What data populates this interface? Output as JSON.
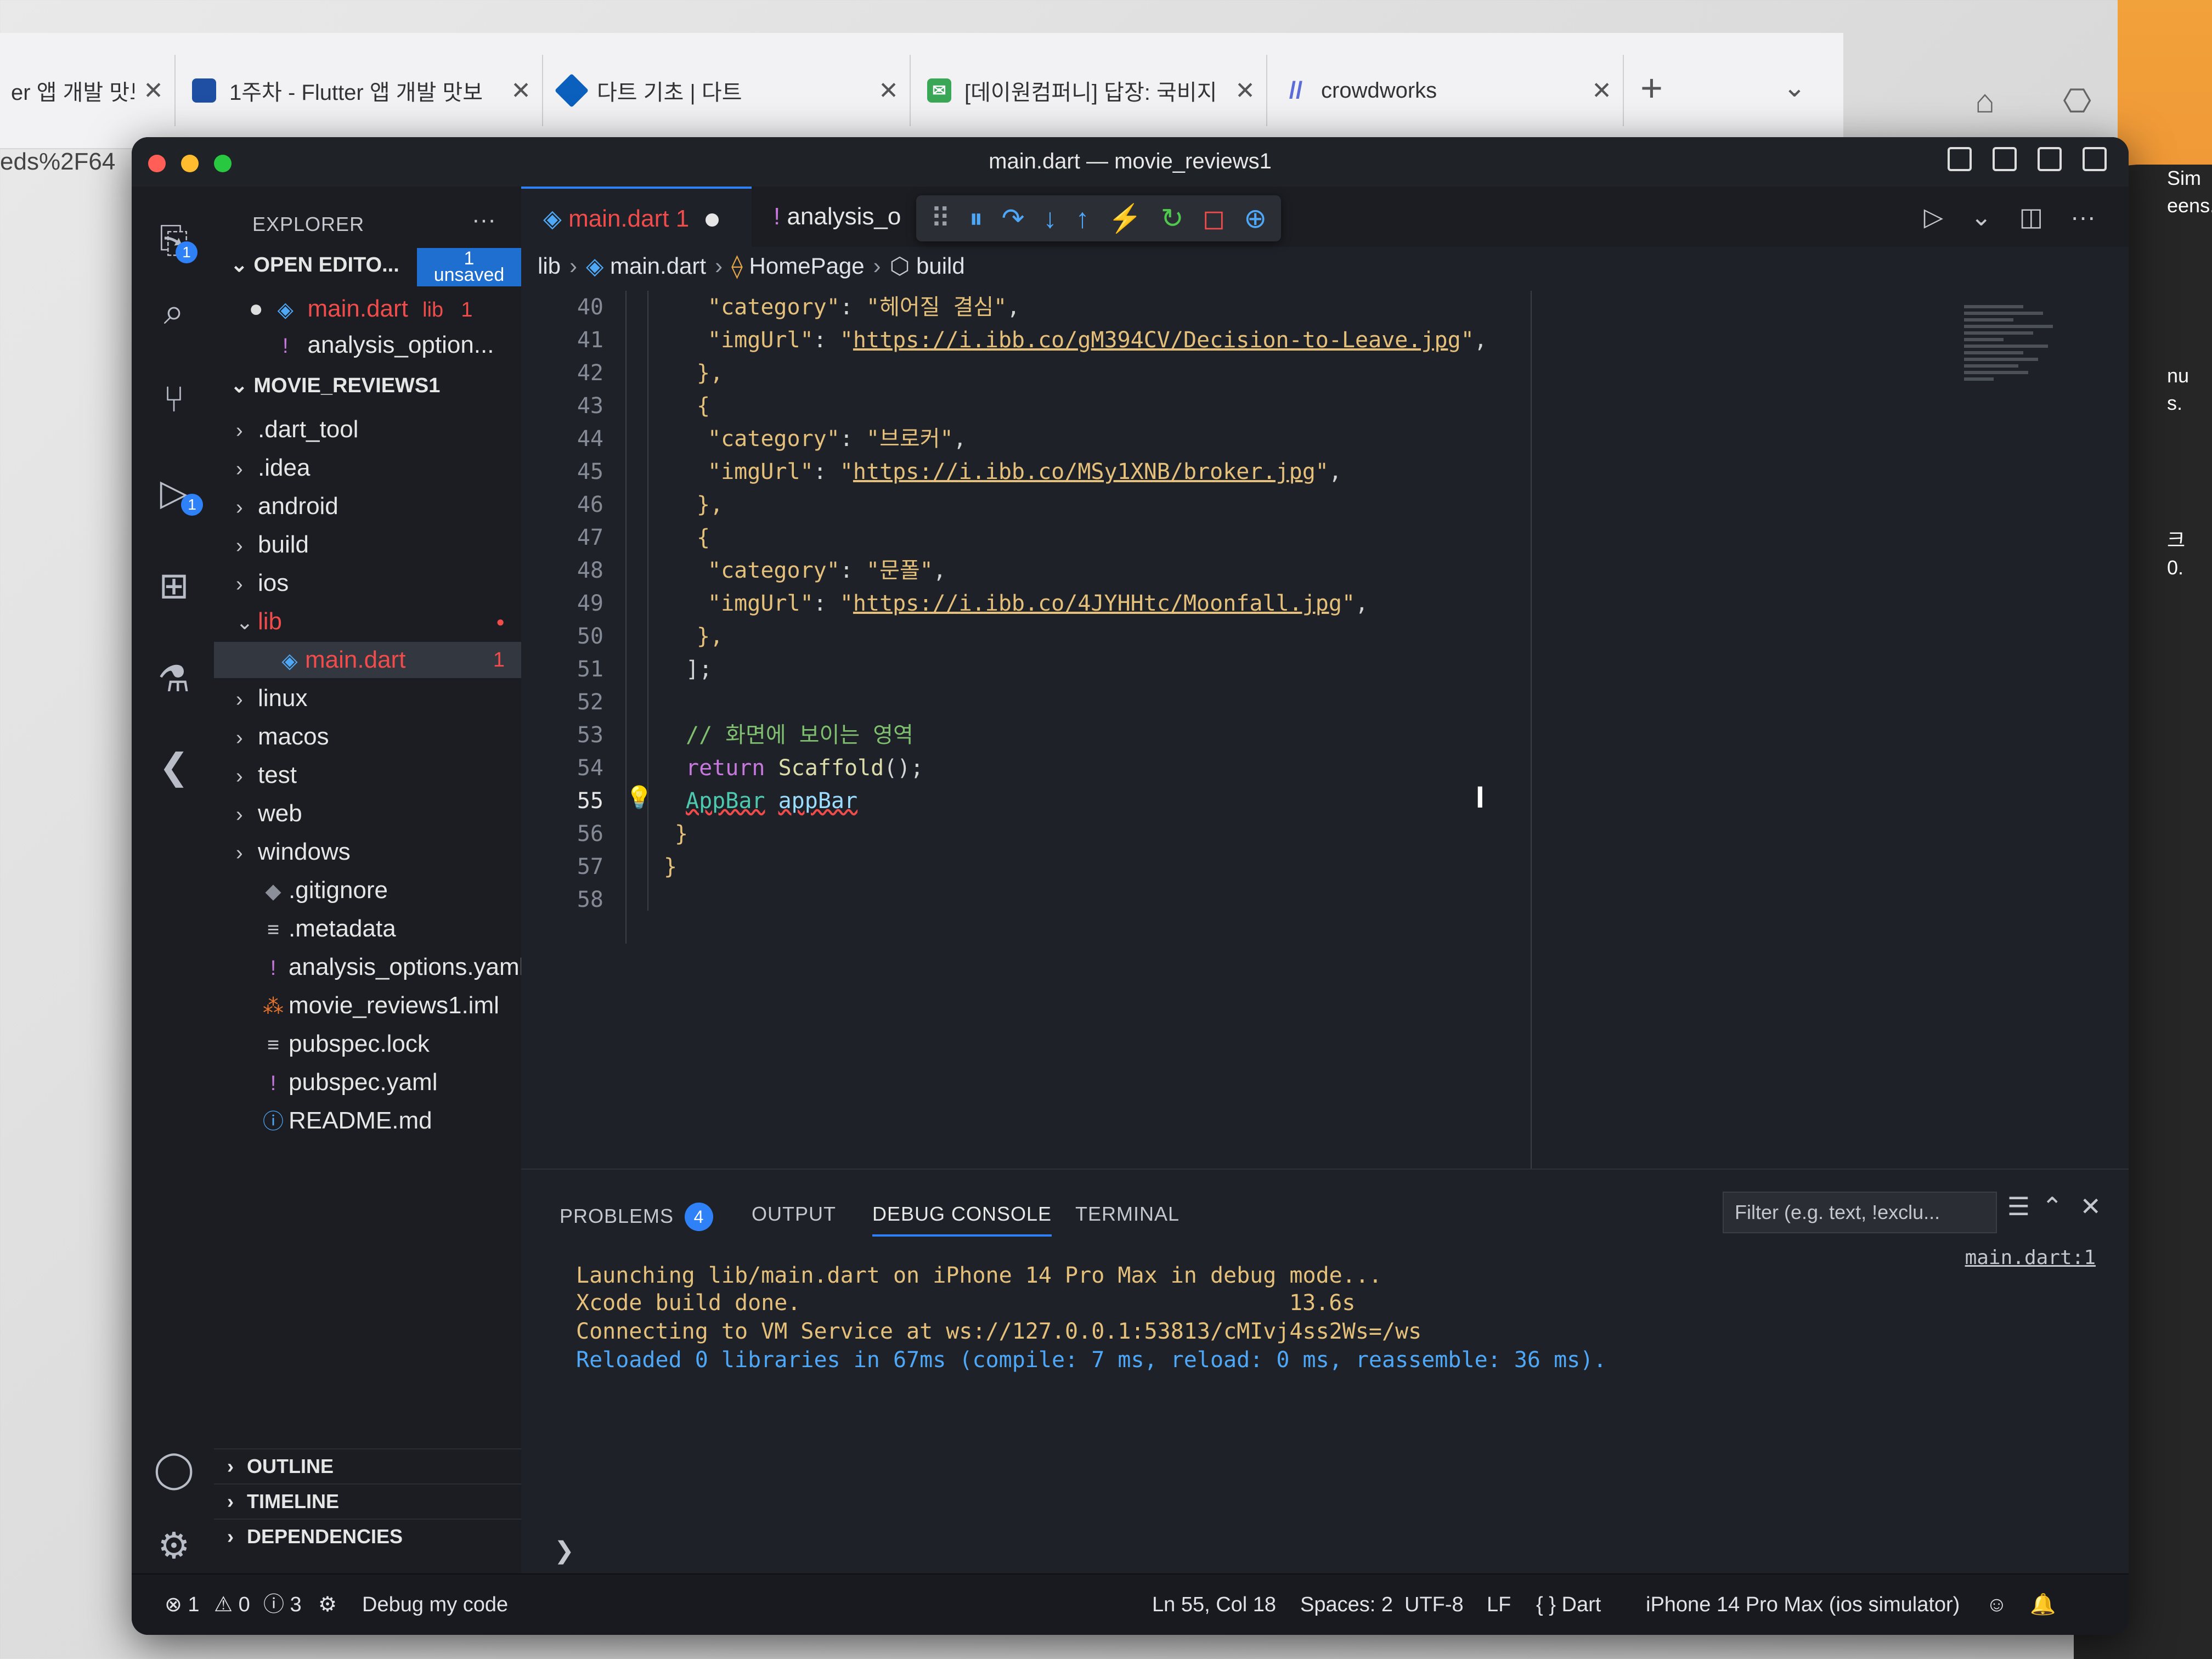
{
  "browser": {
    "tabs": [
      {
        "label": "er 앱 개발 맛보",
        "icon": "tab-icon"
      },
      {
        "label": "1주차 - Flutter 앱 개발 맛보",
        "icon": "doc-icon"
      },
      {
        "label": "다트 기초 | 다트",
        "icon": "dart-icon"
      },
      {
        "label": "[데이원컴퍼니] 답장: 국비지",
        "icon": "mail-icon"
      },
      {
        "label": "crowdworks",
        "icon": "crowdworks-icon"
      }
    ],
    "close_glyph": "✕",
    "new_tab_glyph": "+",
    "dropdown_glyph": "⌄",
    "url_fragment": "eds%2F64",
    "simulator_text": [
      "Sim",
      "eens.",
      "nu",
      "s.",
      "크",
      "0."
    ]
  },
  "window": {
    "title": "main.dart — movie_reviews1"
  },
  "activity_bar": {
    "items": [
      {
        "name": "explorer-icon",
        "glyph": "⎘",
        "badge": "1"
      },
      {
        "name": "search-icon",
        "glyph": "⌕",
        "badge": ""
      },
      {
        "name": "source-control-icon",
        "glyph": "⑂",
        "badge": ""
      },
      {
        "name": "run-debug-icon",
        "glyph": "▷",
        "badge": "1"
      },
      {
        "name": "extensions-icon",
        "glyph": "⊞",
        "badge": ""
      },
      {
        "name": "testing-icon",
        "glyph": "⚗",
        "badge": ""
      },
      {
        "name": "flutter-icon",
        "glyph": "❮",
        "badge": ""
      }
    ],
    "account_glyph": "◯",
    "settings_glyph": "⚙"
  },
  "explorer": {
    "title": "EXPLORER",
    "more_glyph": "···",
    "open_editors": {
      "label": "OPEN EDITO...",
      "badge_count": "1",
      "badge_label": "unsaved",
      "items": [
        {
          "label": "main.dart",
          "detail": "lib",
          "problems": "1"
        },
        {
          "label": "analysis_option..."
        }
      ]
    },
    "project": {
      "label": "MOVIE_REVIEWS1",
      "items": [
        {
          "label": ".dart_tool",
          "type": "folder"
        },
        {
          "label": ".idea",
          "type": "folder"
        },
        {
          "label": "android",
          "type": "folder"
        },
        {
          "label": "build",
          "type": "folder"
        },
        {
          "label": "ios",
          "type": "folder"
        },
        {
          "label": "lib",
          "type": "folder-open"
        },
        {
          "label": "main.dart",
          "type": "file",
          "problems": "1"
        },
        {
          "label": "linux",
          "type": "folder"
        },
        {
          "label": "macos",
          "type": "folder"
        },
        {
          "label": "test",
          "type": "folder"
        },
        {
          "label": "web",
          "type": "folder"
        },
        {
          "label": "windows",
          "type": "folder"
        },
        {
          "label": ".gitignore",
          "type": "file"
        },
        {
          "label": ".metadata",
          "type": "file"
        },
        {
          "label": "analysis_options.yaml",
          "type": "file"
        },
        {
          "label": "movie_reviews1.iml",
          "type": "file"
        },
        {
          "label": "pubspec.lock",
          "type": "file"
        },
        {
          "label": "pubspec.yaml",
          "type": "file"
        },
        {
          "label": "README.md",
          "type": "file"
        }
      ]
    },
    "bottom_sections": [
      "OUTLINE",
      "TIMELINE",
      "DEPENDENCIES"
    ]
  },
  "editor": {
    "tabs": [
      {
        "label": "main.dart 1"
      },
      {
        "label": "analysis_o"
      }
    ],
    "debug_toolbar": [
      "⠿",
      "⏸",
      "↷",
      "↓",
      "↑",
      "⚡",
      "↻",
      "◻",
      "⊕"
    ],
    "actions": [
      "▷",
      "⌄",
      "◫",
      "···"
    ],
    "breadcrumb": [
      "lib",
      "main.dart",
      "HomePage",
      "build"
    ],
    "current_line": "55",
    "lines": [
      {
        "n": "40",
        "tokens": [
          [
            "s-key",
            "\"category\""
          ],
          [
            "",
            ": "
          ],
          [
            "s-str",
            "\"헤어질 결심\""
          ],
          [
            "",
            ","
          ]
        ]
      },
      {
        "n": "41",
        "tokens": [
          [
            "s-key",
            "\"imgUrl\""
          ],
          [
            "",
            ": "
          ],
          [
            "s-str",
            "\""
          ],
          [
            "s-url",
            "https://i.ibb.co/gM394CV/Decision-to-Leave.jpg"
          ],
          [
            "s-str",
            "\""
          ],
          [
            "",
            ","
          ]
        ]
      },
      {
        "n": "42",
        "tokens": [
          [
            "s-brace",
            "},"
          ]
        ]
      },
      {
        "n": "43",
        "tokens": [
          [
            "s-brace",
            "{"
          ]
        ]
      },
      {
        "n": "44",
        "tokens": [
          [
            "s-key",
            "\"category\""
          ],
          [
            "",
            ": "
          ],
          [
            "s-str",
            "\"브로커\""
          ],
          [
            "",
            ","
          ]
        ]
      },
      {
        "n": "45",
        "tokens": [
          [
            "s-key",
            "\"imgUrl\""
          ],
          [
            "",
            ": "
          ],
          [
            "s-str",
            "\""
          ],
          [
            "s-url",
            "https://i.ibb.co/MSy1XNB/broker.jpg"
          ],
          [
            "s-str",
            "\""
          ],
          [
            "",
            ","
          ]
        ]
      },
      {
        "n": "46",
        "tokens": [
          [
            "s-brace",
            "},"
          ]
        ]
      },
      {
        "n": "47",
        "tokens": [
          [
            "s-brace",
            "{"
          ]
        ]
      },
      {
        "n": "48",
        "tokens": [
          [
            "s-key",
            "\"category\""
          ],
          [
            "",
            ": "
          ],
          [
            "s-str",
            "\"문폴\""
          ],
          [
            "",
            ","
          ]
        ]
      },
      {
        "n": "49",
        "tokens": [
          [
            "s-key",
            "\"imgUrl\""
          ],
          [
            "",
            ": "
          ],
          [
            "s-str",
            "\""
          ],
          [
            "s-url",
            "https://i.ibb.co/4JYHHtc/Moonfall.jpg"
          ],
          [
            "s-str",
            "\""
          ],
          [
            "",
            ","
          ]
        ]
      },
      {
        "n": "50",
        "tokens": [
          [
            "s-brace",
            "},"
          ]
        ]
      },
      {
        "n": "51",
        "tokens": [
          [
            "",
            "];"
          ]
        ]
      },
      {
        "n": "52",
        "tokens": []
      },
      {
        "n": "53",
        "tokens": [
          [
            "s-com",
            "// 화면에 보이는 영역"
          ]
        ]
      },
      {
        "n": "54",
        "tokens": [
          [
            "s-kw",
            "return"
          ],
          [
            "",
            " "
          ],
          [
            "s-fn",
            "Scaffold"
          ],
          [
            "",
            "();"
          ]
        ]
      },
      {
        "n": "55",
        "tokens": [
          [
            "s-type",
            "AppBar"
          ],
          [
            "",
            " "
          ],
          [
            "s-var",
            "appBar"
          ]
        ]
      },
      {
        "n": "56",
        "tokens": [
          [
            "s-brace",
            "}"
          ]
        ]
      },
      {
        "n": "57",
        "tokens": [
          [
            "s-brace",
            "}"
          ]
        ]
      },
      {
        "n": "58",
        "tokens": []
      }
    ]
  },
  "panel": {
    "tabs": [
      {
        "label": "PROBLEMS",
        "badge": "4"
      },
      {
        "label": "OUTPUT"
      },
      {
        "label": "DEBUG CONSOLE"
      },
      {
        "label": "TERMINAL"
      }
    ],
    "active_tab": "DEBUG CONSOLE",
    "filter_placeholder": "Filter (e.g. text, !exclu...",
    "controls": [
      "☰",
      "⌃",
      "✕"
    ],
    "source_link": "main.dart:1",
    "console": [
      {
        "text": "Launching lib/main.dart on iPhone 14 Pro Max in debug mode...",
        "color": "yellow"
      },
      {
        "text": "Xcode build done.",
        "color": "yellow"
      },
      {
        "text": "Connecting to VM Service at ws://127.0.0.1:53813/cMIvj4ss2Ws=/ws",
        "color": "yellow"
      },
      {
        "text": "Reloaded 0 libraries in 67ms (compile: 7 ms, reload: 0 ms, reassemble: 36 ms).",
        "color": "blue"
      }
    ],
    "build_time": "13.6s",
    "prompt_glyph": "❯"
  },
  "statusbar": {
    "errors": "⊗ 1",
    "warnings": "⚠ 0",
    "infos": "ⓘ 3",
    "debug_label": "Debug my code",
    "position": "Ln 55, Col 18",
    "spaces": "Spaces: 2",
    "encoding": "UTF-8",
    "eol": "LF",
    "language": "{ } Dart",
    "device": "iPhone 14 Pro Max (ios simulator)"
  },
  "colors": {
    "accent": "#2f81f7",
    "error": "#f14c4c",
    "string": "#e5c07b",
    "comment": "#7fbf6f",
    "keyword": "#c678dd"
  }
}
